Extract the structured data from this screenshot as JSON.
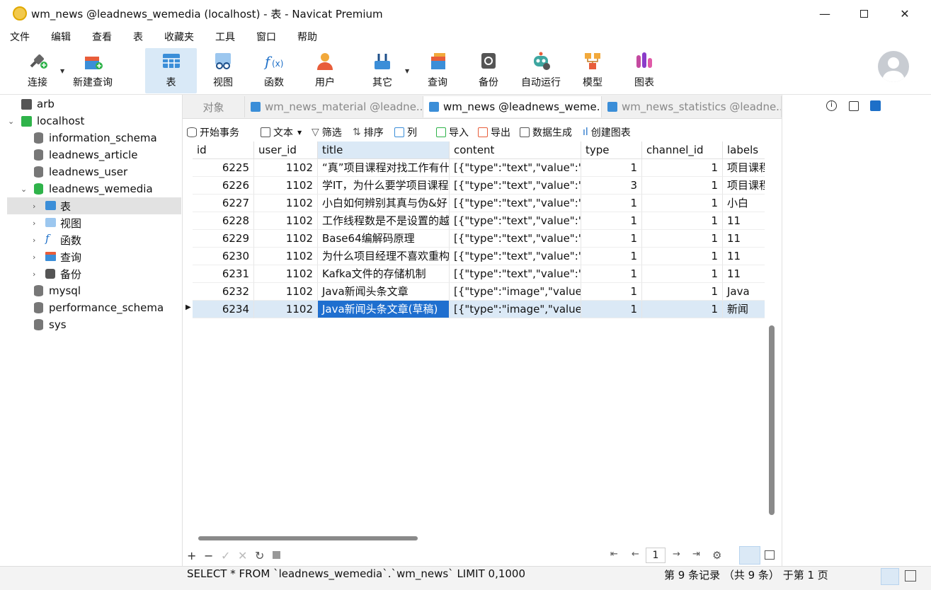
{
  "window": {
    "title": "wm_news @leadnews_wemedia (localhost) - 表 - Navicat Premium"
  },
  "menu": [
    "文件",
    "编辑",
    "查看",
    "表",
    "收藏夹",
    "工具",
    "窗口",
    "帮助"
  ],
  "toolbar": {
    "connect": "连接",
    "new_query": "新建查询",
    "table": "表",
    "view": "视图",
    "function": "函数",
    "user": "用户",
    "other": "其它",
    "query": "查询",
    "backup": "备份",
    "automation": "自动运行",
    "model": "模型",
    "chart": "图表"
  },
  "tree": {
    "arb": "arb",
    "localhost": "localhost",
    "information_schema": "information_schema",
    "leadnews_article": "leadnews_article",
    "leadnews_user": "leadnews_user",
    "leadnews_wemedia": "leadnews_wemedia",
    "tables": "表",
    "views": "视图",
    "functions": "函数",
    "queries": "查询",
    "backups": "备份",
    "mysql": "mysql",
    "performance_schema": "performance_schema",
    "sys": "sys"
  },
  "tabs": {
    "objects": "对象",
    "t1": "wm_news_material @leadne...",
    "t2": "wm_news @leadnews_weme...",
    "t3": "wm_news_statistics @leadne..."
  },
  "objtoolbar": {
    "begin": "开始事务",
    "text": "文本",
    "filter": "筛选",
    "sort": "排序",
    "columns": "列",
    "import": "导入",
    "export": "导出",
    "gen": "数据生成",
    "chart": "创建图表"
  },
  "columns": [
    "id",
    "user_id",
    "title",
    "content",
    "type",
    "channel_id",
    "labels"
  ],
  "rows": [
    [
      "6225",
      "1102",
      "“真”项目课程对找工作有什",
      "[{\"type\":\"text\",\"value\":\"",
      "1",
      "1",
      "项目课程"
    ],
    [
      "6226",
      "1102",
      "学IT，为什么要学项目课程",
      "[{\"type\":\"text\",\"value\":\"",
      "3",
      "1",
      "项目课程"
    ],
    [
      "6227",
      "1102",
      "小白如何辨别其真与伪&好",
      "[{\"type\":\"text\",\"value\":\"",
      "1",
      "1",
      "小白"
    ],
    [
      "6228",
      "1102",
      "工作线程数是不是设置的越",
      "[{\"type\":\"text\",\"value\":\"",
      "1",
      "1",
      "11"
    ],
    [
      "6229",
      "1102",
      "Base64编解码原理",
      "[{\"type\":\"text\",\"value\":\"",
      "1",
      "1",
      "11"
    ],
    [
      "6230",
      "1102",
      "为什么项目经理不喜欢重构",
      "[{\"type\":\"text\",\"value\":\"",
      "1",
      "1",
      "11"
    ],
    [
      "6231",
      "1102",
      "Kafka文件的存储机制",
      "[{\"type\":\"text\",\"value\":\"",
      "1",
      "1",
      "11"
    ],
    [
      "6232",
      "1102",
      "Java新闻头条文章",
      "[{\"type\":\"image\",\"value\"",
      "1",
      "1",
      "Java"
    ],
    [
      "6234",
      "1102",
      "Java新闻头条文章(草稿)",
      "[{\"type\":\"image\",\"value\"",
      "1",
      "1",
      "新闻"
    ]
  ],
  "pager": {
    "page": "1"
  },
  "status": {
    "sql": "SELECT * FROM `leadnews_wemedia`.`wm_news` LIMIT 0,1000",
    "records": "第 9 条记录 （共 9 条） 于第 1 页"
  }
}
